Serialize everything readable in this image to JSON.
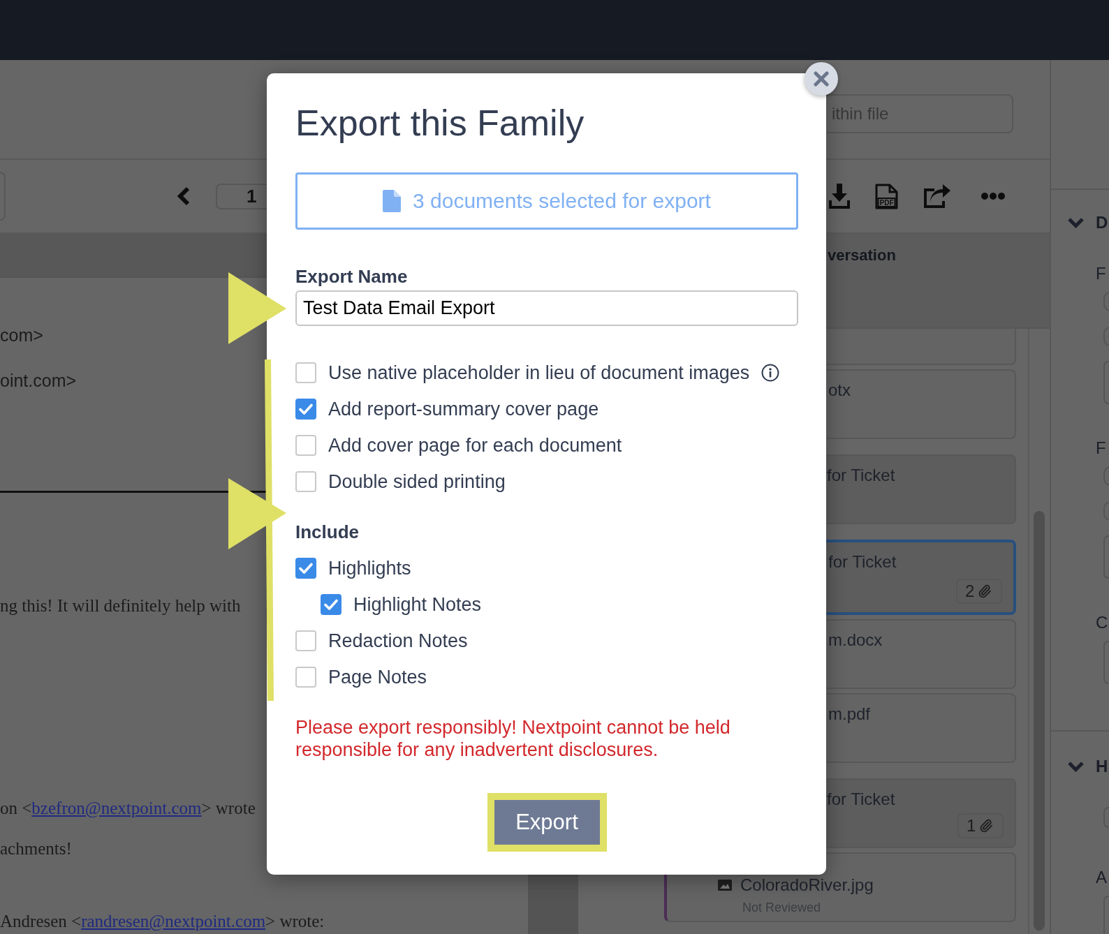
{
  "search": {
    "placeholder": "ithin file"
  },
  "document_toolbar": {
    "page_number": "1",
    "pdf_label": "PDF"
  },
  "email_text": {
    "header_lines": [
      "com>",
      "oint.com>"
    ],
    "body_lines": [
      {
        "kind": "text",
        "text": "ng this! It will definitely help with"
      },
      {
        "kind": "reply_header",
        "text_before": "on <",
        "link": "bzefron@nextpoint.com",
        "text_after": "> wrote"
      },
      {
        "kind": "text",
        "text": "achments!"
      },
      {
        "kind": "reply_header",
        "text_before": "Andresen <",
        "link": "randresen@nextpoint.com",
        "text_after": "> wrote:"
      }
    ]
  },
  "family": {
    "title": "versation"
  },
  "documents": [
    {
      "kind": "attachment",
      "selected": false
    },
    {
      "kind": "attachment",
      "title": "otx",
      "selected": false
    },
    {
      "kind": "email",
      "title": "for Ticket",
      "selected": false
    },
    {
      "kind": "email",
      "title": "for Ticket",
      "selected": true,
      "attachment_count": "2"
    },
    {
      "kind": "attachment",
      "title": "m.docx",
      "selected": false
    },
    {
      "kind": "attachment",
      "title": "m.pdf",
      "selected": false
    },
    {
      "kind": "email",
      "title": "for Ticket",
      "selected": false,
      "attachment_count": "1"
    },
    {
      "kind": "attachment",
      "title": "ColoradoRiver.jpg",
      "status": "Not Reviewed",
      "selected": false
    }
  ],
  "side_panel": {
    "sections": [
      {
        "heading": "D",
        "expanded": true,
        "items": [
          {
            "kind": "label",
            "text": "F"
          },
          {
            "kind": "radio",
            "selected": false
          },
          {
            "kind": "radio",
            "selected": false
          },
          {
            "kind": "textarea"
          },
          {
            "kind": "label",
            "text": "F"
          },
          {
            "kind": "radio",
            "selected": false
          },
          {
            "kind": "radio",
            "selected": false
          },
          {
            "kind": "textarea"
          },
          {
            "kind": "label",
            "text": "C"
          },
          {
            "kind": "textarea"
          }
        ]
      },
      {
        "heading": "H",
        "expanded": true,
        "items": [
          {
            "kind": "input"
          },
          {
            "kind": "label",
            "text": "A"
          },
          {
            "kind": "textarea"
          }
        ]
      }
    ]
  },
  "export_dialog": {
    "title": "Export this Family",
    "selection_summary": "3 documents selected for export",
    "export_name": {
      "label": "Export Name",
      "value": "Test Data Email Export"
    },
    "options": [
      {
        "label": "Use native placeholder in lieu of document images",
        "checked": false,
        "info": true
      },
      {
        "label": "Add report-summary cover page",
        "checked": true,
        "info": false
      },
      {
        "label": "Add cover page for each document",
        "checked": false,
        "info": false
      },
      {
        "label": "Double sided printing",
        "checked": false,
        "info": false
      }
    ],
    "include": {
      "heading": "Include",
      "options": [
        {
          "label": "Highlights",
          "checked": true,
          "children": [
            {
              "label": "Highlight Notes",
              "checked": true
            }
          ]
        },
        {
          "label": "Redaction Notes",
          "checked": false
        },
        {
          "label": "Page Notes",
          "checked": false
        }
      ]
    },
    "warning": "Please export responsibly! Nextpoint cannot be held responsible for any inadvertent disclosures.",
    "export_button": "Export"
  }
}
